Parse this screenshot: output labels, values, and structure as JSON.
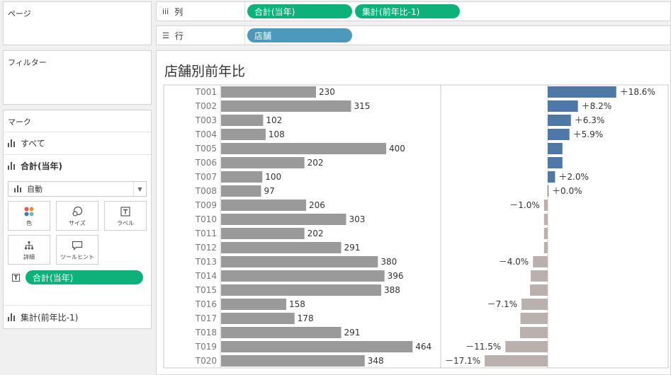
{
  "panels": {
    "pages_title": "ページ",
    "filters_title": "フィルター",
    "marks_title": "マーク"
  },
  "marks": {
    "all_label": "すべて",
    "current_label": "合計(当年)",
    "mark_type": "自動",
    "buttons": {
      "color": "色",
      "size": "サイズ",
      "label": "ラベル",
      "detail": "詳細",
      "tooltip": "ツールヒント"
    },
    "label_pill": "合計(当年)",
    "footer_label": "集計(前年比-1)"
  },
  "shelves": {
    "columns_label": "列",
    "rows_label": "行",
    "column_pills": [
      "合計(当年)",
      "集計(前年比-1)"
    ],
    "row_pill": "店舗"
  },
  "view": {
    "title": "店舗別前年比"
  },
  "colors": {
    "pill_green": "#0fb17a",
    "pill_blue": "#4c9abb",
    "bar_gray": "#9a9a9a",
    "bar_positive": "#4e79a7",
    "bar_negative": "#bab0ac"
  },
  "chart_data": {
    "type": "bar",
    "categories": [
      "T001",
      "T002",
      "T003",
      "T004",
      "T005",
      "T006",
      "T007",
      "T008",
      "T009",
      "T010",
      "T011",
      "T012",
      "T013",
      "T014",
      "T015",
      "T016",
      "T017",
      "T018",
      "T019",
      "T020"
    ],
    "series": [
      {
        "name": "合計(当年)",
        "values": [
          230,
          315,
          102,
          108,
          400,
          202,
          100,
          97,
          206,
          303,
          202,
          291,
          380,
          396,
          388,
          158,
          178,
          291,
          464,
          348
        ],
        "labels": [
          "230",
          "315",
          "102",
          "108",
          "400",
          "202",
          "100",
          "97",
          "206",
          "303",
          "202",
          "291",
          "380",
          "396",
          "388",
          "158",
          "178",
          "291",
          "464",
          "348"
        ]
      },
      {
        "name": "集計(前年比-1)",
        "values": [
          18.6,
          8.2,
          6.3,
          5.9,
          4.0,
          4.0,
          2.0,
          0.0,
          -1.0,
          -1.0,
          -1.0,
          -1.0,
          -4.0,
          -4.6,
          -4.8,
          -7.1,
          -7.4,
          -7.5,
          -11.5,
          -17.1
        ],
        "labels": [
          "＋18.6%",
          "＋8.2%",
          "＋6.3%",
          "＋5.9%",
          "",
          "",
          "＋2.0%",
          "＋0.0%",
          "－1.0%",
          "",
          "",
          "",
          "－4.0%",
          "",
          "",
          "－7.1%",
          "",
          "",
          "－11.5%",
          "－17.1%"
        ]
      }
    ]
  }
}
